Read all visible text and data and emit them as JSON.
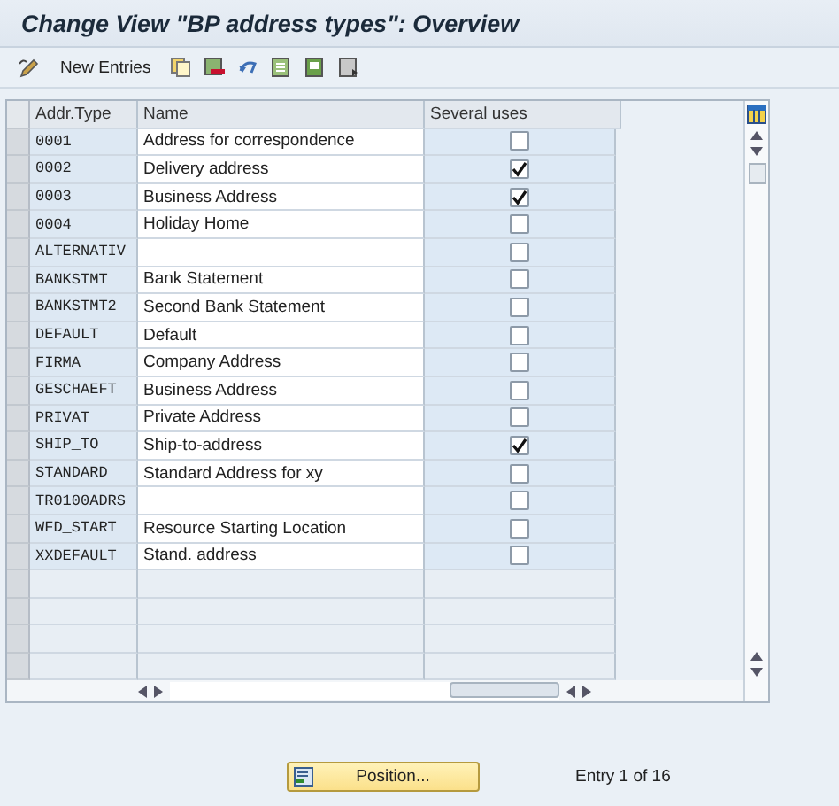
{
  "window": {
    "title": "Change View \"BP address types\": Overview"
  },
  "toolbar": {
    "new_entries": "New Entries"
  },
  "table": {
    "columns": [
      "Addr.Type",
      "Name",
      "Several uses"
    ],
    "rows": [
      {
        "type": "0001",
        "name": "Address for correspondence",
        "several_uses": false
      },
      {
        "type": "0002",
        "name": "Delivery address",
        "several_uses": true
      },
      {
        "type": "0003",
        "name": "Business Address",
        "several_uses": true
      },
      {
        "type": "0004",
        "name": "Holiday Home",
        "several_uses": false
      },
      {
        "type": "ALTERNATIV",
        "name": "",
        "several_uses": false
      },
      {
        "type": "BANKSTMT",
        "name": "Bank Statement",
        "several_uses": false
      },
      {
        "type": "BANKSTMT2",
        "name": "Second Bank Statement",
        "several_uses": false
      },
      {
        "type": "DEFAULT",
        "name": "Default",
        "several_uses": false
      },
      {
        "type": "FIRMA",
        "name": "Company Address",
        "several_uses": false
      },
      {
        "type": "GESCHAEFT",
        "name": "Business Address",
        "several_uses": false
      },
      {
        "type": "PRIVAT",
        "name": "Private Address",
        "several_uses": false
      },
      {
        "type": "SHIP_TO",
        "name": "Ship-to-address",
        "several_uses": true
      },
      {
        "type": "STANDARD",
        "name": "Standard Address for xy",
        "several_uses": false
      },
      {
        "type": "TR0100ADRS",
        "name": "",
        "several_uses": false
      },
      {
        "type": "WFD_START",
        "name": "Resource Starting Location",
        "several_uses": false
      },
      {
        "type": "XXDEFAULT",
        "name": "Stand. address",
        "several_uses": false
      }
    ]
  },
  "footer": {
    "position_button": "Position...",
    "entry_info": "Entry 1 of 16"
  }
}
